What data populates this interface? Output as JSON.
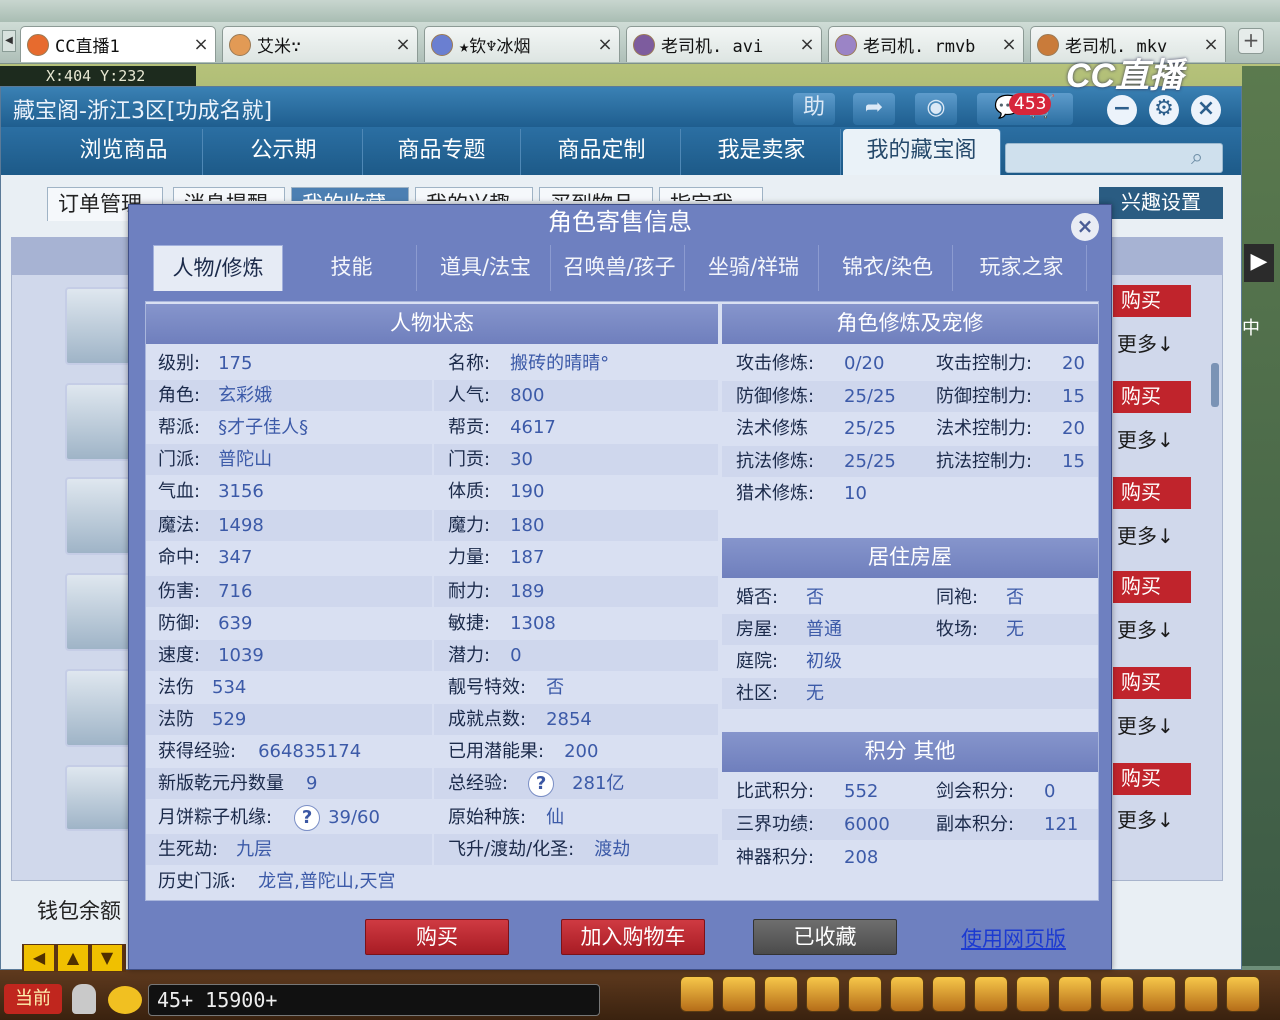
{
  "browser": {
    "tabs": [
      {
        "label": "CC直播1",
        "close": "×",
        "color": "#e76b2e"
      },
      {
        "label": "艾米∵",
        "close": "×",
        "color": "#e29a55"
      },
      {
        "label": "★钦♆冰烟",
        "close": "×",
        "color": "#6a7fd1"
      },
      {
        "label": "老司机. avi",
        "close": "×",
        "color": "#7d5c9e"
      },
      {
        "label": "老司机. rmvb",
        "close": "×",
        "color": "#9b84c6"
      },
      {
        "label": "老司机. mkv",
        "close": "×",
        "color": "#c97b3a"
      }
    ],
    "new_tab": "+"
  },
  "stream_logo": "CC直播",
  "game": {
    "coords": "X:404 Y:232",
    "side_label": "中",
    "level_text": "45+ 15900+",
    "current_btn": "当前",
    "arrows": [
      "◀",
      "▲",
      "▼"
    ]
  },
  "window": {
    "title": "藏宝阁-浙江3区[功成名就]",
    "help_label": "助",
    "cart_badge": "453",
    "nav": [
      "浏览商品",
      "公示期",
      "商品专题",
      "商品定制",
      "我是卖家",
      "我的藏宝阁"
    ],
    "sub_tabs": [
      "订单管理",
      "消息提醒",
      "我的收藏",
      "我的兴趣",
      "买到物品",
      "指定我"
    ],
    "interest_btn": "兴趣设置",
    "buy_label": "购买",
    "more_label": "更多↓",
    "wallet": "钱包余额"
  },
  "modal": {
    "title": "角色寄售信息",
    "close": "×",
    "tabs": [
      "人物/修炼",
      "技能",
      "道具/法宝",
      "召唤兽/孩子",
      "坐骑/祥瑞",
      "锦衣/染色",
      "玩家之家"
    ],
    "status_title": "人物状态",
    "status_left": [
      {
        "k": "级别:",
        "v": "175"
      },
      {
        "k": "角色:",
        "v": "玄彩娥"
      },
      {
        "k": "帮派:",
        "v": "§才子佳人§"
      },
      {
        "k": "门派:",
        "v": "普陀山"
      },
      {
        "k": "气血:",
        "v": "3156"
      },
      {
        "k": "魔法:",
        "v": "1498"
      },
      {
        "k": "命中:",
        "v": "347"
      },
      {
        "k": "伤害:",
        "v": "716"
      },
      {
        "k": "防御:",
        "v": "639"
      },
      {
        "k": "速度:",
        "v": "1039"
      },
      {
        "k": "法伤",
        "v": "534"
      },
      {
        "k": "法防",
        "v": "529"
      },
      {
        "k": "获得经验:",
        "v": "664835174"
      },
      {
        "k": "新版乾元丹数量",
        "v": "9"
      },
      {
        "k": "月饼粽子机缘:",
        "v": "39/60",
        "q": "?"
      },
      {
        "k": "生死劫:",
        "v": "九层"
      },
      {
        "k": "历史门派:",
        "v": "龙宫,普陀山,天宫"
      }
    ],
    "status_right": [
      {
        "k": "名称:",
        "v": "搬砖的晴晴°"
      },
      {
        "k": "人气:",
        "v": "800"
      },
      {
        "k": "帮贡:",
        "v": "4617"
      },
      {
        "k": "门贡:",
        "v": "30"
      },
      {
        "k": "体质:",
        "v": "190"
      },
      {
        "k": "魔力:",
        "v": "180"
      },
      {
        "k": "力量:",
        "v": "187"
      },
      {
        "k": "耐力:",
        "v": "189"
      },
      {
        "k": "敏捷:",
        "v": "1308"
      },
      {
        "k": "潜力:",
        "v": "0"
      },
      {
        "k": "靓号特效:",
        "v": "否"
      },
      {
        "k": "成就点数:",
        "v": "2854"
      },
      {
        "k": "已用潜能果:",
        "v": "200"
      },
      {
        "k": "总经验:",
        "v": "281亿",
        "q": "?"
      },
      {
        "k": "原始种族:",
        "v": "仙"
      },
      {
        "k": "飞升/渡劫/化圣:",
        "v": "渡劫"
      }
    ],
    "cultivation_title": "角色修炼及宠修",
    "cultivation": [
      {
        "k1": "攻击修炼:",
        "v1": "0/20",
        "k2": "攻击控制力:",
        "v2": "20"
      },
      {
        "k1": "防御修炼:",
        "v1": "25/25",
        "k2": "防御控制力:",
        "v2": "15"
      },
      {
        "k1": "法术修炼",
        "v1": "25/25",
        "k2": "法术控制力:",
        "v2": "20"
      },
      {
        "k1": "抗法修炼:",
        "v1": "25/25",
        "k2": "抗法控制力:",
        "v2": "15"
      },
      {
        "k1": "猎术修炼:",
        "v1": "10",
        "k2": "",
        "v2": ""
      }
    ],
    "house_title": "居住房屋",
    "house": [
      {
        "k1": "婚否:",
        "v1": "否",
        "k2": "同袍:",
        "v2": "否"
      },
      {
        "k1": "房屋:",
        "v1": "普通",
        "k2": "牧场:",
        "v2": "无"
      },
      {
        "k1": "庭院:",
        "v1": "初级",
        "k2": "",
        "v2": ""
      },
      {
        "k1": "社区:",
        "v1": "无",
        "k2": "",
        "v2": ""
      }
    ],
    "points_title": "积分 其他",
    "points": [
      {
        "k1": "比武积分:",
        "v1": "552",
        "k2": "剑会积分:",
        "v2": "0"
      },
      {
        "k1": "三界功绩:",
        "v1": "6000",
        "k2": "副本积分:",
        "v2": "121"
      },
      {
        "k1": "神器积分:",
        "v1": "208",
        "k2": "",
        "v2": ""
      }
    ],
    "buttons": {
      "buy": "购买",
      "add_cart": "加入购物车",
      "favorited": "已收藏",
      "web": "使用网页版"
    }
  }
}
